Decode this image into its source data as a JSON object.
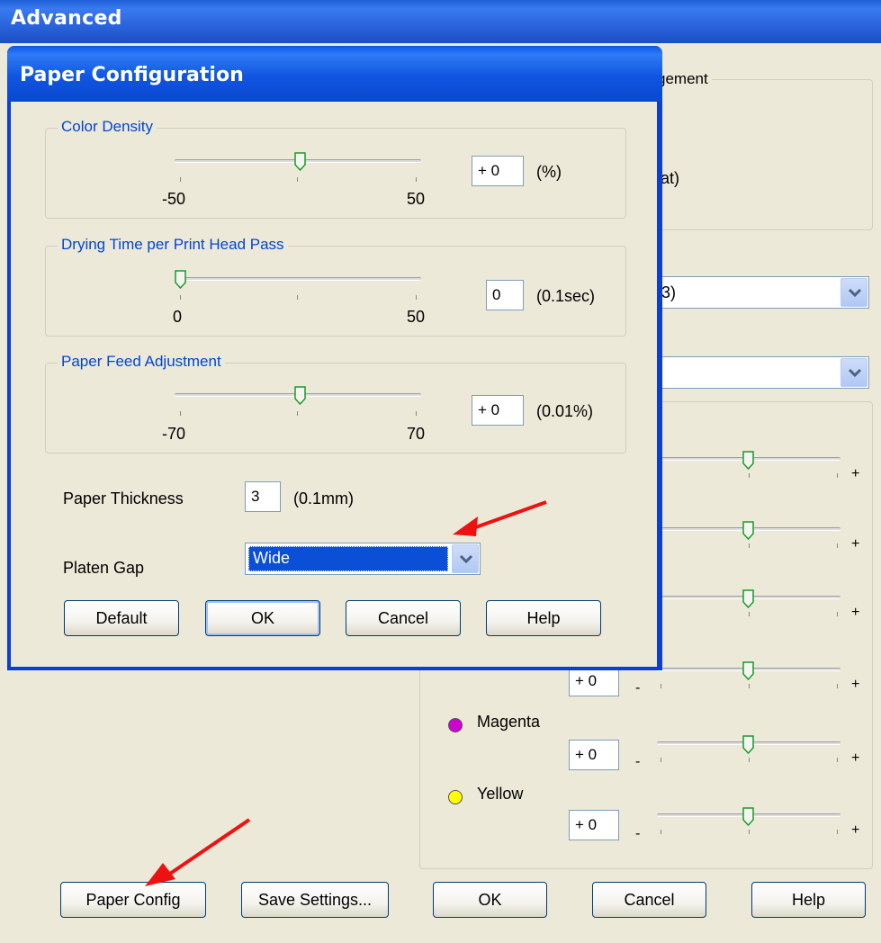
{
  "advanced": {
    "title": "Advanced",
    "group_title_partial": "gement",
    "option_partial": "at)",
    "dropdown1_value_partial": "3)",
    "dropdown2_value_partial": "",
    "colors": [
      {
        "name": "Magenta",
        "value": "+ 0",
        "color": "#d000d0"
      },
      {
        "name": "Yellow",
        "value": "+ 0",
        "color": "#ffff00"
      }
    ],
    "unnamed_values": [
      "+ 0"
    ],
    "slider_minus": "-",
    "slider_plus": "+",
    "buttons": {
      "paper_config": "Paper Config",
      "save_settings": "Save Settings...",
      "ok": "OK",
      "cancel": "Cancel",
      "help": "Help"
    }
  },
  "paper_config": {
    "title": "Paper Configuration",
    "color_density": {
      "label": "Color Density",
      "min": "-50",
      "max": "50",
      "value": "+ 0",
      "unit": "(%)",
      "level": 0
    },
    "drying_time": {
      "label": "Drying Time per Print Head Pass",
      "min": "0",
      "max": "50",
      "value": "0",
      "unit": "(0.1sec)",
      "level": 0
    },
    "paper_feed": {
      "label": "Paper Feed Adjustment",
      "min": "-70",
      "max": "70",
      "value": "+ 0",
      "unit": "(0.01%)",
      "level": 0
    },
    "paper_thickness": {
      "label": "Paper Thickness",
      "value": "3",
      "unit": "(0.1mm)"
    },
    "platen_gap": {
      "label": "Platen Gap",
      "value": "Wide"
    },
    "buttons": {
      "default": "Default",
      "ok": "OK",
      "cancel": "Cancel",
      "help": "Help"
    }
  },
  "colors_ui": {
    "title_bar": "#2a63dc",
    "dialog_face": "#ece9d8",
    "selection": "#0a4fd6",
    "annotation_arrow": "#ee1111",
    "group_label": "#0046d5"
  }
}
